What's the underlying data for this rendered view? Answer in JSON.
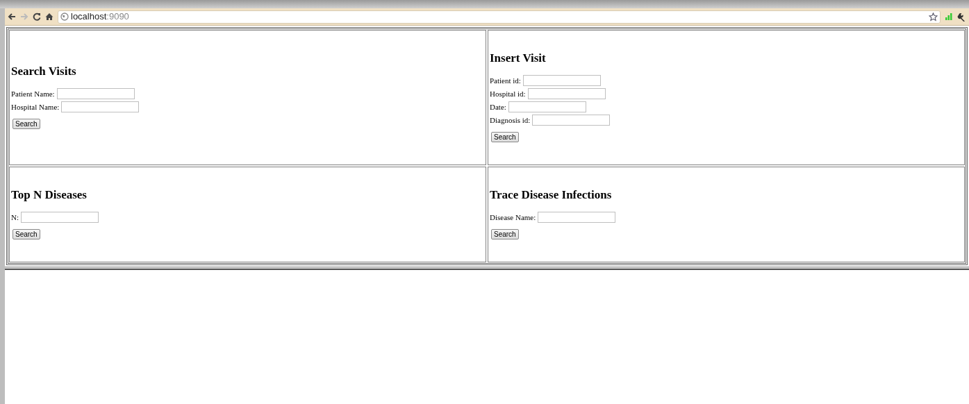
{
  "browser": {
    "url_host": "localhost",
    "url_port": ":9090"
  },
  "panel_rows": [
    {
      "panels": [
        {
          "title": "Search Visits",
          "fields": [
            {
              "label": "Patient Name:"
            },
            {
              "label": "Hospital Name:"
            }
          ],
          "button": "Search"
        },
        {
          "title": "Insert Visit",
          "fields": [
            {
              "label": "Patient id:"
            },
            {
              "label": "Hospital id:"
            },
            {
              "label": "Date:"
            },
            {
              "label": "Diagnosis id:"
            }
          ],
          "button": "Search"
        }
      ]
    },
    {
      "panels": [
        {
          "title": "Top N Diseases",
          "fields": [
            {
              "label": "N:"
            }
          ],
          "button": "Search"
        },
        {
          "title": "Trace Disease Infections",
          "fields": [
            {
              "label": "Disease Name:"
            }
          ],
          "button": "Search"
        }
      ]
    }
  ]
}
